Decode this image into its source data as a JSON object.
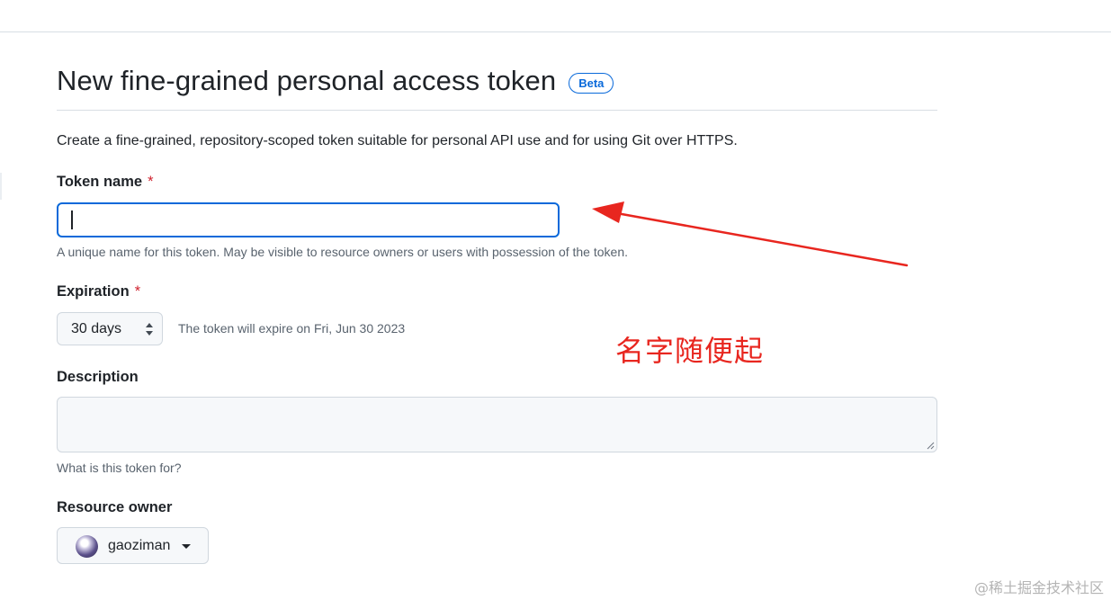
{
  "header": {
    "title": "New fine-grained personal access token",
    "badge": "Beta"
  },
  "intro": "Create a fine-grained, repository-scoped token suitable for personal API use and for using Git over HTTPS.",
  "token_name": {
    "label": "Token name",
    "required_mark": "*",
    "value": "",
    "hint": "A unique name for this token. May be visible to resource owners or users with possession of the token."
  },
  "expiration": {
    "label": "Expiration",
    "required_mark": "*",
    "selected": "30 days",
    "note": "The token will expire on Fri, Jun 30 2023"
  },
  "description": {
    "label": "Description",
    "value": "",
    "hint": "What is this token for?"
  },
  "resource_owner": {
    "label": "Resource owner",
    "selected": "gaoziman"
  },
  "annotation": {
    "text": "名字随便起",
    "color": "#e8261f"
  },
  "watermark": "@稀土掘金技术社区",
  "colors": {
    "accent": "#0969da",
    "required": "#cf222e",
    "muted": "#59636e"
  }
}
